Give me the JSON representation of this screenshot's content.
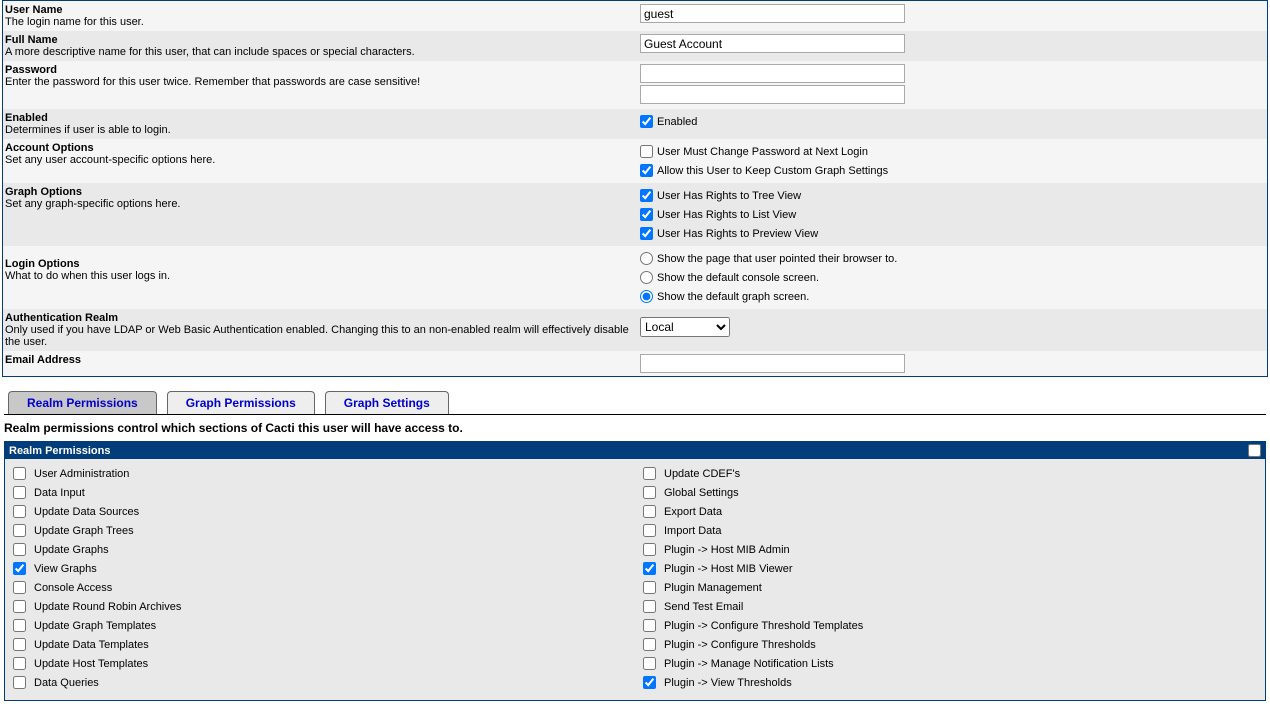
{
  "form": {
    "username": {
      "label": "User Name",
      "desc": "The login name for this user.",
      "value": "guest"
    },
    "fullname": {
      "label": "Full Name",
      "desc": "A more descriptive name for this user, that can include spaces or special characters.",
      "value": "Guest Account"
    },
    "password": {
      "label": "Password",
      "desc": "Enter the password for this user twice. Remember that passwords are case sensitive!",
      "value1": "",
      "value2": ""
    },
    "enabled": {
      "label": "Enabled",
      "desc": "Determines if user is able to login.",
      "checkbox_label": "Enabled",
      "checked": true
    },
    "account_options": {
      "label": "Account Options",
      "desc": "Set any user account-specific options here.",
      "opts": [
        {
          "label": "User Must Change Password at Next Login",
          "checked": false
        },
        {
          "label": "Allow this User to Keep Custom Graph Settings",
          "checked": true
        }
      ]
    },
    "graph_options": {
      "label": "Graph Options",
      "desc": "Set any graph-specific options here.",
      "opts": [
        {
          "label": "User Has Rights to Tree View",
          "checked": true
        },
        {
          "label": "User Has Rights to List View",
          "checked": true
        },
        {
          "label": "User Has Rights to Preview View",
          "checked": true
        }
      ]
    },
    "login_options": {
      "label": "Login Options",
      "desc": "What to do when this user logs in.",
      "opts": [
        {
          "label": "Show the page that user pointed their browser to.",
          "selected": false
        },
        {
          "label": "Show the default console screen.",
          "selected": false
        },
        {
          "label": "Show the default graph screen.",
          "selected": true
        }
      ]
    },
    "auth_realm": {
      "label": "Authentication Realm",
      "desc": "Only used if you have LDAP or Web Basic Authentication enabled. Changing this to an non-enabled realm will effectively disable the user.",
      "value": "Local"
    },
    "email": {
      "label": "Email Address",
      "value": ""
    }
  },
  "tabs": [
    {
      "label": "Realm Permissions",
      "active": true
    },
    {
      "label": "Graph Permissions",
      "active": false
    },
    {
      "label": "Graph Settings",
      "active": false
    }
  ],
  "tab_desc": "Realm permissions control which sections of Cacti this user will have access to.",
  "perms": {
    "header": "Realm Permissions",
    "left": [
      {
        "label": "User Administration",
        "checked": false
      },
      {
        "label": "Data Input",
        "checked": false
      },
      {
        "label": "Update Data Sources",
        "checked": false
      },
      {
        "label": "Update Graph Trees",
        "checked": false
      },
      {
        "label": "Update Graphs",
        "checked": false
      },
      {
        "label": "View Graphs",
        "checked": true
      },
      {
        "label": "Console Access",
        "checked": false
      },
      {
        "label": "Update Round Robin Archives",
        "checked": false
      },
      {
        "label": "Update Graph Templates",
        "checked": false
      },
      {
        "label": "Update Data Templates",
        "checked": false
      },
      {
        "label": "Update Host Templates",
        "checked": false
      },
      {
        "label": "Data Queries",
        "checked": false
      }
    ],
    "right": [
      {
        "label": "Update CDEF's",
        "checked": false
      },
      {
        "label": "Global Settings",
        "checked": false
      },
      {
        "label": "Export Data",
        "checked": false
      },
      {
        "label": "Import Data",
        "checked": false
      },
      {
        "label": "Plugin -> Host MIB Admin",
        "checked": false
      },
      {
        "label": "Plugin -> Host MIB Viewer",
        "checked": true
      },
      {
        "label": "Plugin Management",
        "checked": false
      },
      {
        "label": "Send Test Email",
        "checked": false
      },
      {
        "label": "Plugin -> Configure Threshold Templates",
        "checked": false
      },
      {
        "label": "Plugin -> Configure Thresholds",
        "checked": false
      },
      {
        "label": "Plugin -> Manage Notification Lists",
        "checked": false
      },
      {
        "label": "Plugin -> View Thresholds",
        "checked": true
      }
    ]
  }
}
